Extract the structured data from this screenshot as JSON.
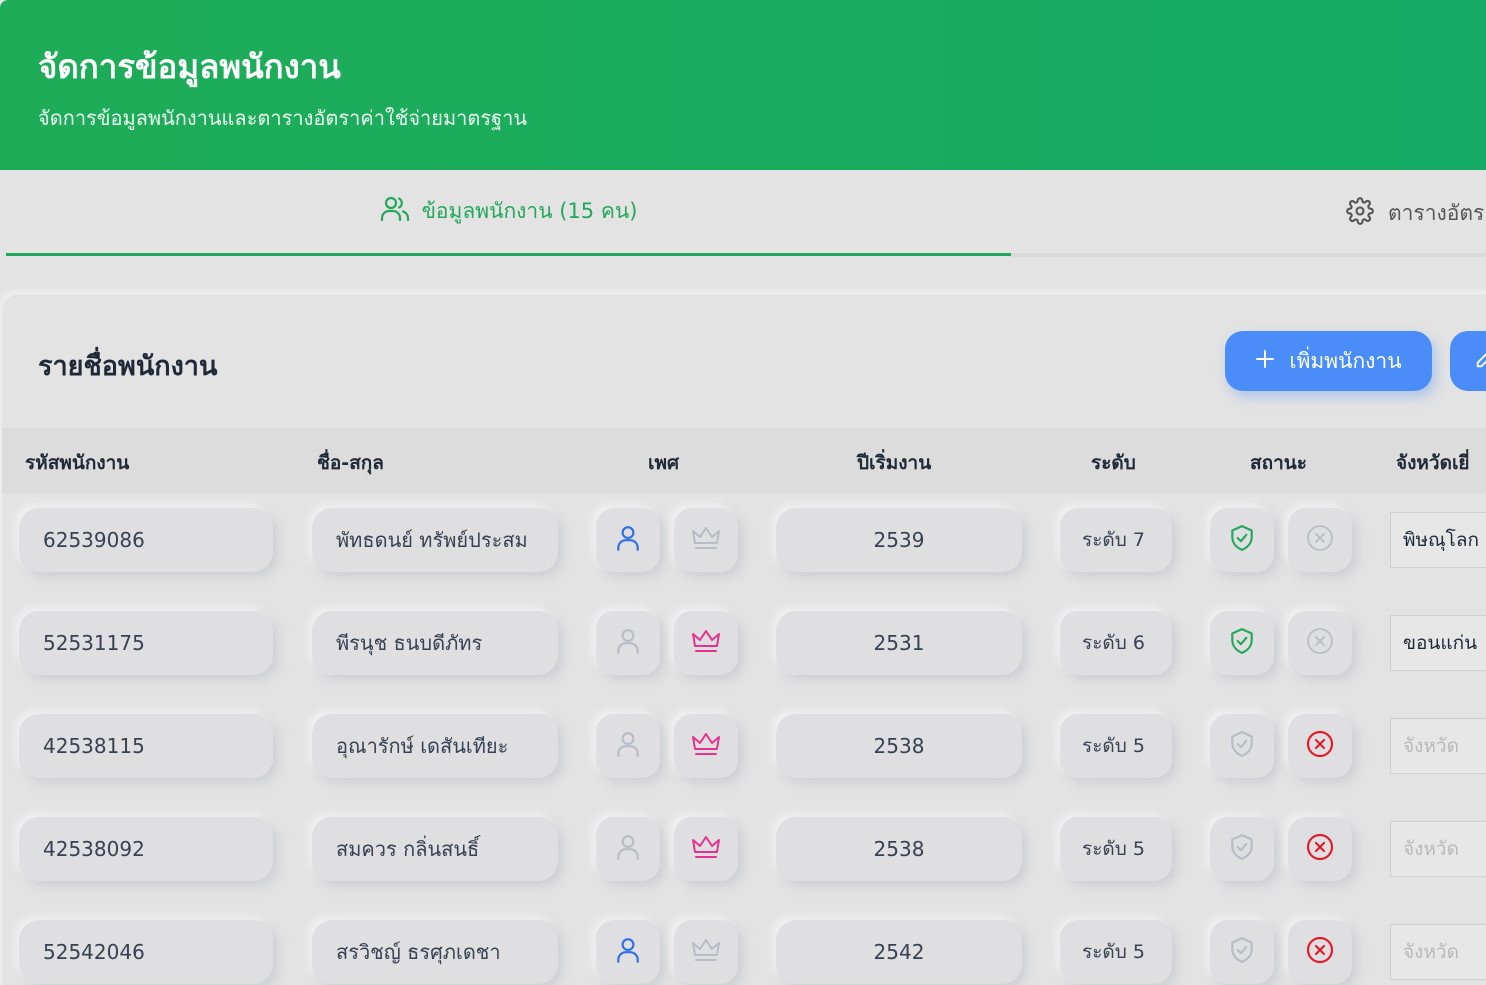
{
  "header": {
    "title": "จัดการข้อมูลพนักงาน",
    "subtitle": "จัดการข้อมูลพนักงานและตารางอัตราค่าใช้จ่ายมาตรฐาน"
  },
  "tabs": {
    "employees_label": "ข้อมูลพนักงาน (15 คน)",
    "rates_label": "ตารางอัตร"
  },
  "card": {
    "title": "รายชื่อพนักงาน",
    "add_button": "เพิ่มพนักงาน"
  },
  "table": {
    "columns": {
      "id": "รหัสพนักงาน",
      "name": "ชื่อ-สกุล",
      "gender": "เพศ",
      "start_year": "ปีเริ่มงาน",
      "level": "ระดับ",
      "status": "สถานะ",
      "province": "จังหวัดเยี่"
    },
    "rows": [
      {
        "id": "62539086",
        "name": "พัทธดนย์ ทรัพย์ประสม",
        "gender": "male",
        "start_year": "2539",
        "level": "ระดับ 7",
        "status": "active",
        "province": "พิษณุโลก",
        "province_placeholder": ""
      },
      {
        "id": "52531175",
        "name": "พีรนุช ธนบดีภัทร",
        "gender": "female",
        "start_year": "2531",
        "level": "ระดับ 6",
        "status": "active",
        "province": "ขอนแก่น",
        "province_placeholder": ""
      },
      {
        "id": "42538115",
        "name": "อุณารักษ์ เดสันเทียะ",
        "gender": "female",
        "start_year": "2538",
        "level": "ระดับ 5",
        "status": "inactive",
        "province": "",
        "province_placeholder": "จังหวัด"
      },
      {
        "id": "42538092",
        "name": "สมควร กลิ่นสนธิ์",
        "gender": "female",
        "start_year": "2538",
        "level": "ระดับ 5",
        "status": "inactive",
        "province": "",
        "province_placeholder": "จังหวัด"
      },
      {
        "id": "52542046",
        "name": "สรวิชญ์ ธรศุภเดชา",
        "gender": "male",
        "start_year": "2542",
        "level": "ระดับ 5",
        "status": "inactive",
        "province": "",
        "province_placeholder": "จังหวัด"
      }
    ]
  },
  "colors": {
    "header_green": "#1fac58",
    "accent_green": "#22a85a",
    "accent_blue": "#4a8df8",
    "male_blue": "#2f6fe8",
    "female_pink": "#e5318f",
    "danger_red": "#e11d2d",
    "muted_gray": "#b8bcc4"
  },
  "icons": {
    "tab_employees": "users-icon",
    "tab_rates": "gear-icon",
    "add": "plus-icon",
    "edit": "pencil-icon",
    "male": "user-icon",
    "female": "crown-icon",
    "active": "shield-check-icon",
    "inactive": "x-circle-icon"
  }
}
